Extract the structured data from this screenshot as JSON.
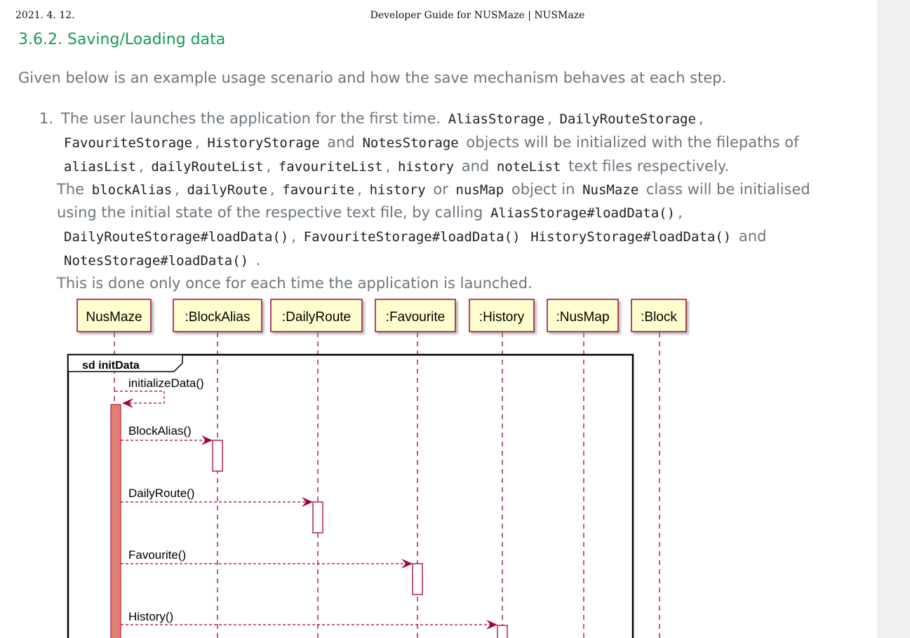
{
  "print_header": {
    "date": "2021. 4. 12.",
    "title": "Developer Guide for NUSMaze | NUSMaze"
  },
  "section_heading": "3.6.2. Saving/Loading data",
  "intro": "Given below is an example usage scenario and how the save mechanism behaves at each step.",
  "step1": {
    "number": "1.",
    "l1": {
      "t1": "The user launches the application for the first time.",
      "c1": "AliasStorage",
      "t2": ",",
      "c2": "DailyRouteStorage",
      "t3": ","
    },
    "l2": {
      "c1": "FavouriteStorage",
      "t1": ",",
      "c2": "HistoryStorage",
      "t2": "and",
      "c3": "NotesStorage",
      "t3": "objects will be initialized with the filepaths of"
    },
    "l3": {
      "c1": "aliasList",
      "t1": ",",
      "c2": "dailyRouteList",
      "t2": ",",
      "c3": "favouriteList",
      "t3": ",",
      "c4": "history",
      "t4": "and",
      "c5": "noteList",
      "t5": "text files respectively."
    },
    "l4": {
      "t1": "The",
      "c1": "blockAlias",
      "t2": ",",
      "c2": "dailyRoute",
      "t3": ",",
      "c3": "favourite",
      "t4": ",",
      "c4": "history",
      "t5": "or",
      "c5": "nusMap",
      "t6": "object in",
      "c6": "NusMaze",
      "t7": "class will be initialised"
    },
    "l5": {
      "t1": "using the initial state of the respective text file, by calling",
      "c1": "AliasStorage#loadData()",
      "t2": ","
    },
    "l6": {
      "c1": "DailyRouteStorage#loadData()",
      "t1": ",",
      "c2": "FavouriteStorage#loadData()",
      "c3": "HistoryStorage#loadData()",
      "t2": "and"
    },
    "l7": {
      "c1": "NotesStorage#loadData()",
      "t1": "."
    },
    "l8": "This is done only once for each time the application is launched."
  },
  "diagram": {
    "participants": [
      ":NusMaze",
      ":BlockAlias",
      ":DailyRoute",
      ":Favourite",
      ":History",
      ":NusMap",
      ":Block"
    ],
    "participants_display": [
      "NusMaze",
      ":BlockAlias",
      ":DailyRoute",
      ":Favourite",
      ":History",
      ":NusMap",
      ":Block"
    ],
    "frame_label": "sd initData",
    "messages": [
      {
        "from": "NusMaze",
        "to": "NusMaze",
        "label": "initializeData()"
      },
      {
        "from": "NusMaze",
        "to": ":BlockAlias",
        "label": "BlockAlias()"
      },
      {
        "from": "NusMaze",
        "to": ":DailyRoute",
        "label": "DailyRoute()"
      },
      {
        "from": "NusMaze",
        "to": ":Favourite",
        "label": "Favourite()"
      },
      {
        "from": "NusMaze",
        "to": ":History",
        "label": "History()"
      }
    ],
    "colors": {
      "box_fill": "#fefece",
      "box_border": "#a80036",
      "lifeline": "#a80036",
      "activation_main": "#e08070"
    }
  }
}
